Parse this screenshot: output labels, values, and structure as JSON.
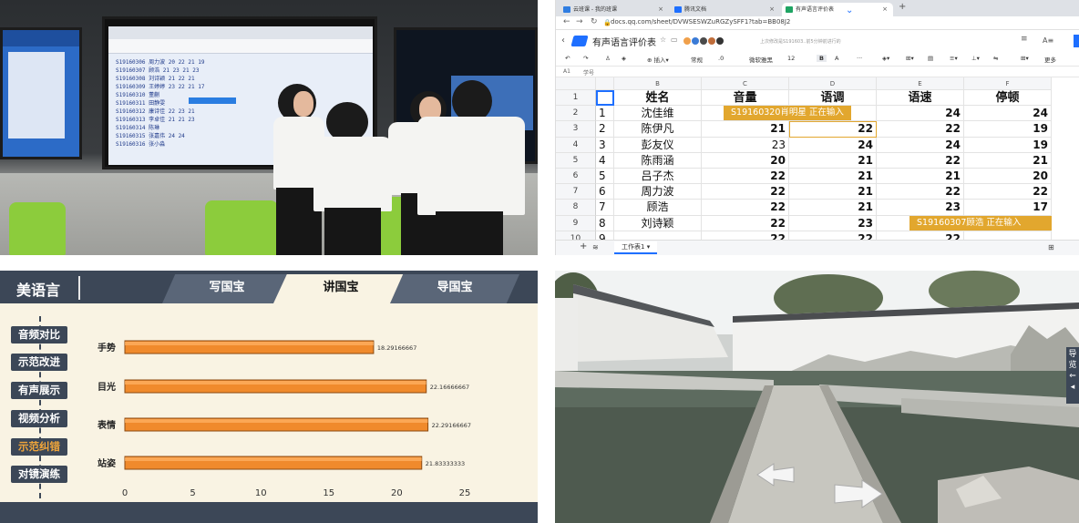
{
  "browser": {
    "tabs": [
      {
        "label": "云班课 - 我的班课",
        "icon_color": "#2f7de1"
      },
      {
        "label": "腾讯文档",
        "icon_color": "#1e6fff"
      },
      {
        "label": "有声语言评价表",
        "icon_color": "#1fa463"
      }
    ],
    "url": "docs.qq.com/sheet/DVWSESWZuRGZySFF1?tab=BB08J2"
  },
  "doc": {
    "title": "有声语言评价表",
    "saved_note": "上次修改是S191603..前5分钟前进行的",
    "toolbar": [
      "插入",
      "常规",
      ".0",
      "微软雅黑",
      "12",
      "B",
      "A",
      "更多"
    ],
    "cell_ref": "A1",
    "cell_content": "学号",
    "columns": [
      "B",
      "C",
      "D",
      "E",
      "F"
    ],
    "rows": [
      {
        "n": "1",
        "idx": "",
        "name": "姓名",
        "c": "音量",
        "d": "语调",
        "e": "语速",
        "f": "停顿"
      },
      {
        "n": "2",
        "idx": "1",
        "name": "沈佳维",
        "c": "",
        "d": "",
        "e": "24",
        "f": "24"
      },
      {
        "n": "3",
        "idx": "2",
        "name": "陈伊凡",
        "c": "21",
        "d": "22",
        "e": "22",
        "f": "19"
      },
      {
        "n": "4",
        "idx": "3",
        "name": "彭友仪",
        "c": "23",
        "d": "24",
        "e": "24",
        "f": "19"
      },
      {
        "n": "5",
        "idx": "4",
        "name": "陈雨涵",
        "c": "20",
        "d": "21",
        "e": "22",
        "f": "21"
      },
      {
        "n": "6",
        "idx": "5",
        "name": "吕子杰",
        "c": "22",
        "d": "21",
        "e": "21",
        "f": "20"
      },
      {
        "n": "7",
        "idx": "6",
        "name": "周力波",
        "c": "22",
        "d": "21",
        "e": "22",
        "f": "22"
      },
      {
        "n": "8",
        "idx": "7",
        "name": "顾浩",
        "c": "22",
        "d": "21",
        "e": "23",
        "f": "17"
      },
      {
        "n": "9",
        "idx": "8",
        "name": "刘诗颖",
        "c": "22",
        "d": "23",
        "e": "",
        "f": ""
      },
      {
        "n": "10",
        "idx": "9",
        "name": "",
        "c": "22",
        "d": "22",
        "e": "22",
        "f": ""
      }
    ],
    "presence": [
      {
        "label": "S19160320肖明星 正在输入"
      },
      {
        "label": "S19160307顾浩 正在输入"
      }
    ],
    "sheet_tab": "工作表1"
  },
  "classroom_screen": {
    "rows": [
      "S19160306  周力波  20  22  21  19",
      "S19160307  顾浩    21  23  21  23",
      "S19160308  刘诗颖  21  22  21",
      "S19160309  王婷婷  23  22  21  17",
      "S19160310  董蒯",
      "S19160311  田静雯",
      "S19160312  康诗佳  22  23  21",
      "S19160313  李卓佳  21  21  23",
      "S19160314  陈琳",
      "S19160315  张嘉伟  24  24",
      "S19160316  张小淼"
    ]
  },
  "app": {
    "title": "美语言",
    "tabs": [
      "写国宝",
      "讲国宝",
      "导国宝"
    ],
    "active_tab": "讲国宝",
    "menu": [
      "音频对比",
      "示范改进",
      "有声展示",
      "视频分析",
      "示范纠错",
      "对镜演练"
    ],
    "active_menu": "示范纠错"
  },
  "chart_data": {
    "type": "bar",
    "orientation": "horizontal",
    "categories": [
      "手势",
      "目光",
      "表情",
      "站姿"
    ],
    "values": [
      18.29166667,
      22.16666667,
      22.29166667,
      21.83333333
    ],
    "value_labels": [
      "18.29166667",
      "22.16666667",
      "22.29166667",
      "21.83333333"
    ],
    "xlim": [
      0,
      25
    ],
    "xticks": [
      "0",
      "5",
      "10",
      "15",
      "20",
      "25"
    ],
    "bar_color": "#f08a2c",
    "grid": false
  },
  "pano": {
    "side_nav": [
      "导",
      "览"
    ]
  }
}
